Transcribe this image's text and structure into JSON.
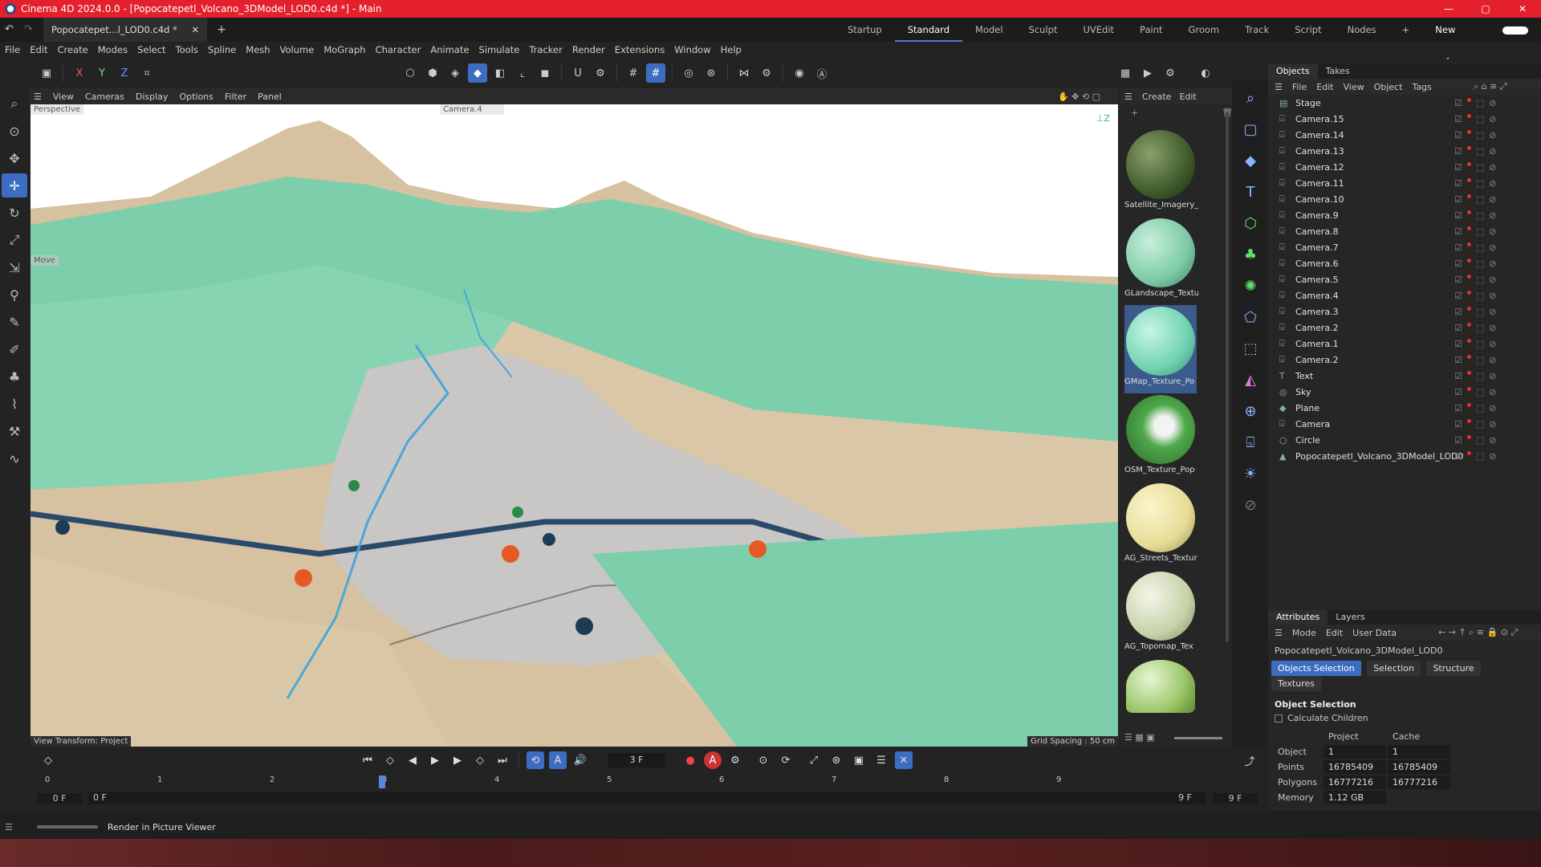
{
  "window": {
    "title": "Cinema 4D 2024.0.0 - [Popocatepetl_Volcano_3DModel_LOD0.c4d *] - Main",
    "controls": [
      "—",
      "▢",
      "✕"
    ]
  },
  "doc_tab": "Popocatepet...l_LOD0.c4d *",
  "layouts": [
    "Startup",
    "Standard",
    "Model",
    "Sculpt",
    "UVEdit",
    "Paint",
    "Groom",
    "Track",
    "Script",
    "Nodes"
  ],
  "new_layouts": "New Layouts",
  "menus": [
    "File",
    "Edit",
    "Create",
    "Modes",
    "Select",
    "Tools",
    "Spline",
    "Mesh",
    "Volume",
    "MoGraph",
    "Character",
    "Animate",
    "Simulate",
    "Tracker",
    "Render",
    "Extensions",
    "Window",
    "Help"
  ],
  "viewport": {
    "menu": [
      "View",
      "Cameras",
      "Display",
      "Options",
      "Filter",
      "Panel"
    ],
    "view_name": "Perspective",
    "camera_label": "Camera.4",
    "move_label": "Move",
    "view_transform": "View Transform: Project",
    "grid_spacing": "Grid Spacing : 50 cm"
  },
  "materials": {
    "menu": [
      "Create",
      "Edit"
    ],
    "items": [
      {
        "name": "Satellite_Imagery_",
        "color": "#3f5a2c"
      },
      {
        "name": "GLandscape_Textu",
        "color": "#7ccaa6"
      },
      {
        "name": "GMap_Texture_Po",
        "color": "#6fd2b0"
      },
      {
        "name": "OSM_Texture_Pop",
        "color": "#4ea84a"
      },
      {
        "name": "AG_Streets_Textur",
        "color": "#e6dc96"
      },
      {
        "name": "AG_Topomap_Tex",
        "color": "#c6d2a8"
      },
      {
        "name": "",
        "color": "#9cc86a"
      }
    ]
  },
  "objects_panel": {
    "tabs": [
      "Objects",
      "Takes"
    ],
    "menu": [
      "File",
      "Edit",
      "View",
      "Object",
      "Tags"
    ],
    "items": [
      "Stage",
      "Camera.15",
      "Camera.14",
      "Camera.13",
      "Camera.12",
      "Camera.11",
      "Camera.10",
      "Camera.9",
      "Camera.8",
      "Camera.7",
      "Camera.6",
      "Camera.5",
      "Camera.4",
      "Camera.3",
      "Camera.2",
      "Camera.1",
      "Camera.2",
      "Text",
      "Sky",
      "Plane",
      "Camera",
      "Circle",
      "Popocatepetl_Volcano_3DModel_LOD0"
    ]
  },
  "attributes": {
    "tabs": [
      "Attributes",
      "Layers"
    ],
    "menu": [
      "Mode",
      "Edit",
      "User Data"
    ],
    "object_name": "Popocatepetl_Volcano_3DModel_LOD0",
    "buttons": [
      "Objects Selection",
      "Selection",
      "Structure",
      "Textures"
    ],
    "section": "Object Selection",
    "calc_children": "Calculate Children",
    "columns": [
      "Project",
      "Cache"
    ],
    "rows": [
      {
        "label": "Object",
        "project": "1",
        "cache": "1"
      },
      {
        "label": "Points",
        "project": "16785409",
        "cache": "16785409"
      },
      {
        "label": "Polygons",
        "project": "16777216",
        "cache": "16777216"
      },
      {
        "label": "Memory",
        "project": "1.12 GB",
        "cache": ""
      }
    ]
  },
  "timeline": {
    "frame_field": "3 F",
    "ticks": [
      "0",
      "1",
      "2",
      "3",
      "4",
      "5",
      "6",
      "7",
      "8",
      "9"
    ],
    "start": "0 F",
    "start2": "0 F",
    "end": "9 F",
    "end2": "9 F",
    "current_frame": 3
  },
  "status": "Render in Picture Viewer"
}
